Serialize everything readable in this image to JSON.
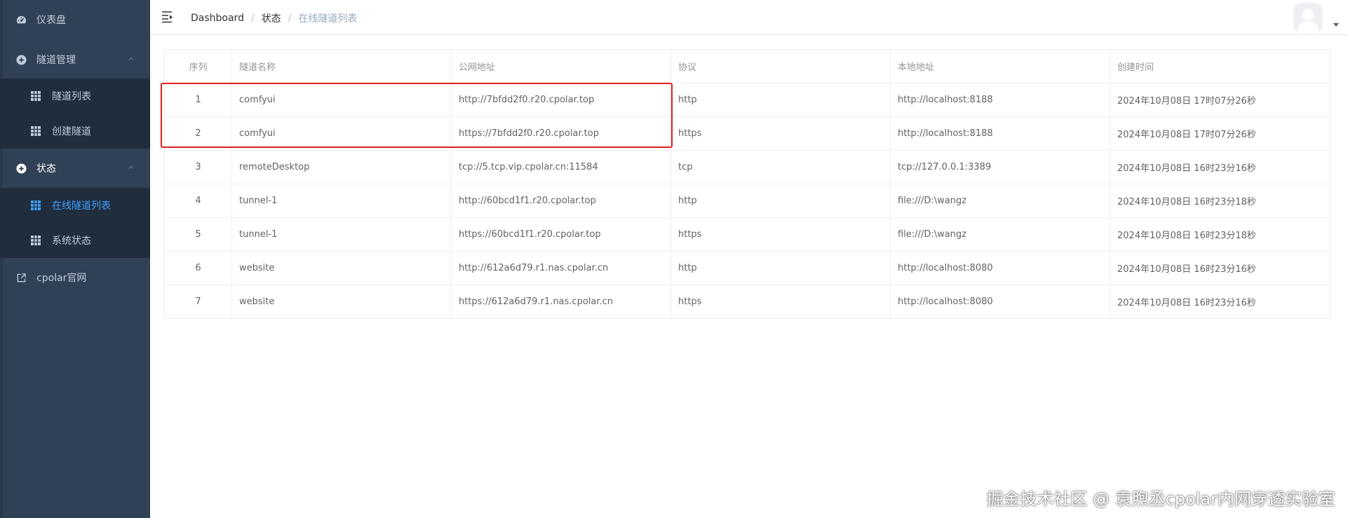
{
  "sidebar": {
    "items": [
      {
        "label": "仪表盘",
        "icon": "dashboard-gauge-icon"
      },
      {
        "label": "隧道管理",
        "icon": "circle-plus-icon",
        "expanded": true,
        "children": [
          {
            "label": "隧道列表",
            "icon": "grid-table-icon"
          },
          {
            "label": "创建隧道",
            "icon": "grid-table-icon"
          }
        ]
      },
      {
        "label": "状态",
        "icon": "circle-plus-icon",
        "expanded": true,
        "children": [
          {
            "label": "在线隧道列表",
            "icon": "grid-table-icon",
            "active": true
          },
          {
            "label": "系统状态",
            "icon": "grid-table-icon"
          }
        ]
      },
      {
        "label": "cpolar官网",
        "icon": "external-link-icon"
      }
    ]
  },
  "header": {
    "breadcrumb": [
      "Dashboard",
      "状态",
      "在线隧道列表"
    ],
    "separator": "/"
  },
  "table": {
    "columns": [
      "序列",
      "隧道名称",
      "公网地址",
      "协议",
      "本地地址",
      "创建时间"
    ],
    "rows": [
      [
        "1",
        "comfyui",
        "http://7bfdd2f0.r20.cpolar.top",
        "http",
        "http://localhost:8188",
        "2024年10月08日 17时07分26秒"
      ],
      [
        "2",
        "comfyui",
        "https://7bfdd2f0.r20.cpolar.top",
        "https",
        "http://localhost:8188",
        "2024年10月08日 17时07分26秒"
      ],
      [
        "3",
        "remoteDesktop",
        "tcp://5.tcp.vip.cpolar.cn:11584",
        "tcp",
        "tcp://127.0.0.1:3389",
        "2024年10月08日 16时23分16秒"
      ],
      [
        "4",
        "tunnel-1",
        "http://60bcd1f1.r20.cpolar.top",
        "http",
        "file:///D:\\wangz",
        "2024年10月08日 16时23分18秒"
      ],
      [
        "5",
        "tunnel-1",
        "https://60bcd1f1.r20.cpolar.top",
        "https",
        "file:///D:\\wangz",
        "2024年10月08日 16时23分18秒"
      ],
      [
        "6",
        "website",
        "http://612a6d79.r1.nas.cpolar.cn",
        "http",
        "http://localhost:8080",
        "2024年10月08日 16时23分16秒"
      ],
      [
        "7",
        "website",
        "https://612a6d79.r1.nas.cpolar.cn",
        "https",
        "http://localhost:8080",
        "2024年10月08日 16时23分16秒"
      ]
    ]
  },
  "watermark": "掘金技术社区 @ 袁煦丞cpolar内网穿透实验室",
  "colors": {
    "sidebar_bg": "#304156",
    "submenu_bg": "#1f2d3d",
    "active": "#409eff",
    "highlight": "#e02020"
  }
}
